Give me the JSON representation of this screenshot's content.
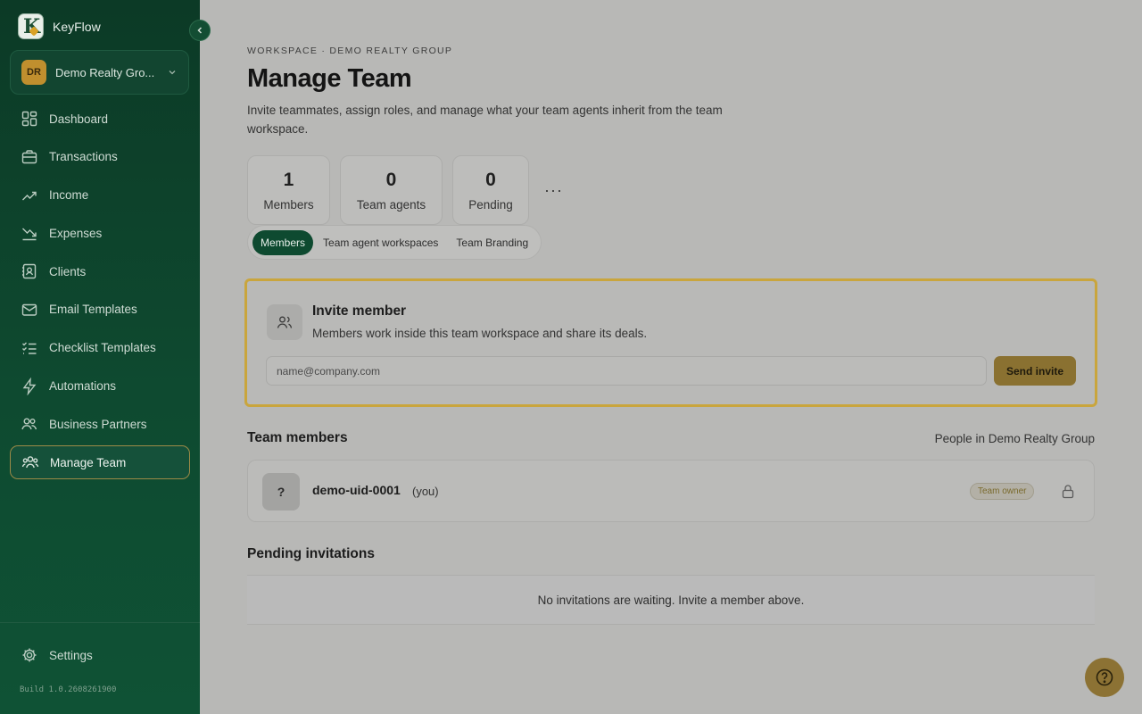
{
  "app": {
    "name": "KeyFlow",
    "build": "Build 1.0.2608261900"
  },
  "workspace": {
    "initials": "DR",
    "name": "Demo Realty Gro..."
  },
  "sidebar": {
    "items": [
      {
        "label": "Dashboard",
        "icon": "grid-icon"
      },
      {
        "label": "Transactions",
        "icon": "briefcase-icon"
      },
      {
        "label": "Income",
        "icon": "trending-up-icon"
      },
      {
        "label": "Expenses",
        "icon": "trending-down-icon"
      },
      {
        "label": "Clients",
        "icon": "contacts-icon"
      },
      {
        "label": "Email Templates",
        "icon": "mail-icon"
      },
      {
        "label": "Checklist Templates",
        "icon": "checklist-icon"
      },
      {
        "label": "Automations",
        "icon": "bolt-icon"
      },
      {
        "label": "Business Partners",
        "icon": "users-icon"
      },
      {
        "label": "Manage Team",
        "icon": "team-icon",
        "active": true
      }
    ],
    "settings": "Settings"
  },
  "header": {
    "eyebrow": "WORKSPACE · DEMO REALTY GROUP",
    "title": "Manage Team",
    "subtitle": "Invite teammates, assign roles, and manage what your team agents inherit from the team workspace."
  },
  "stats": [
    {
      "value": "1",
      "label": "Members"
    },
    {
      "value": "0",
      "label": "Team agents"
    },
    {
      "value": "0",
      "label": "Pending"
    }
  ],
  "more": "···",
  "tabs": [
    {
      "label": "Members",
      "active": true
    },
    {
      "label": "Team agent workspaces"
    },
    {
      "label": "Team Branding"
    }
  ],
  "invite": {
    "title": "Invite member",
    "description": "Members work inside this team workspace and share its deals.",
    "placeholder": "name@company.com",
    "button": "Send invite"
  },
  "team_members": {
    "title": "Team members",
    "meta": "People in Demo Realty Group",
    "rows": [
      {
        "avatar": "?",
        "name": "demo-uid-0001",
        "suffix": "(you)",
        "badge": "Team owner"
      }
    ]
  },
  "pending": {
    "title": "Pending invitations",
    "empty": "No invitations are waiting. Invite a member above."
  },
  "colors": {
    "sidebar": "#0e4a30",
    "accent": "#c9a53d",
    "overlay": "#b8b8b6"
  }
}
